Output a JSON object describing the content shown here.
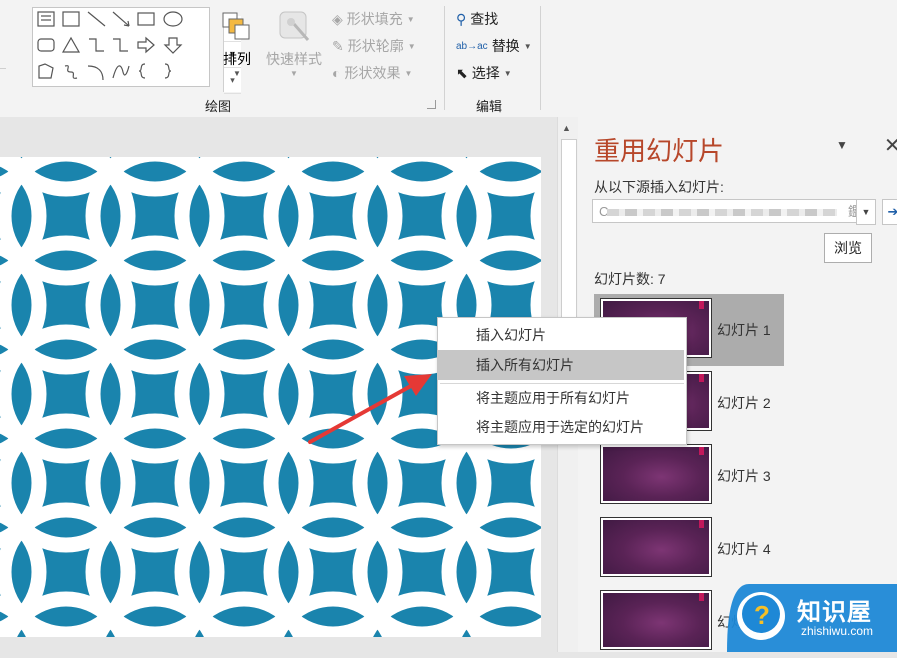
{
  "ribbon": {
    "drawing_group_label": "绘图",
    "editing_group_label": "编辑",
    "arrange_label": "排列",
    "quick_styles_label": "快速样式",
    "shape_fill_label": "形状填充",
    "shape_outline_label": "形状轮廓",
    "shape_effects_label": "形状效果",
    "find_label": "查找",
    "replace_label": "替换",
    "select_label": "选择"
  },
  "pane": {
    "title": "重用幻灯片",
    "source_label": "从以下源插入幻灯片:",
    "source_value_tail": "鑑",
    "browse_label": "浏览",
    "count_label": "幻灯片数: 7",
    "slides": [
      {
        "label": "幻灯片 1"
      },
      {
        "label": "幻灯片 2"
      },
      {
        "label": "幻灯片 3"
      },
      {
        "label": "幻灯片 4"
      },
      {
        "label": "幻灯片 5"
      }
    ]
  },
  "context_menu": {
    "items": [
      {
        "label": "插入幻灯片"
      },
      {
        "label": "插入所有幻灯片"
      },
      {
        "label": "将主题应用于所有幻灯片"
      },
      {
        "label": "将主题应用于选定的幻灯片"
      }
    ]
  },
  "watermark": {
    "brand": "知识屋",
    "url": "zhishiwu.com"
  },
  "colors": {
    "slide_background": "#1a84ad",
    "pane_title": "#b7472a",
    "arrow": "#e53935",
    "thumbnail": "#5a2356"
  }
}
